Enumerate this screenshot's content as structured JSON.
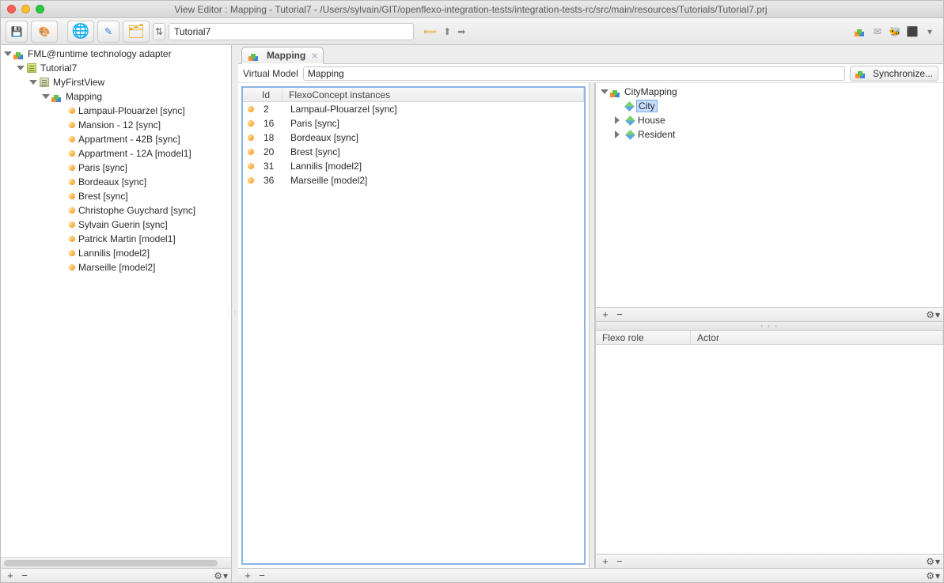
{
  "window": {
    "title": "View Editor : Mapping - Tutorial7 - /Users/sylvain/GIT/openflexo-integration-tests/integration-tests-rc/src/main/resources/Tutorials/Tutorial7.prj"
  },
  "toolbar": {
    "address_value": "Tutorial7"
  },
  "left_tree": {
    "root": "FML@runtime technology adapter",
    "project": "Tutorial7",
    "view": "MyFirstView",
    "mapping": "Mapping",
    "items": [
      "Lampaul-Plouarzel [sync]",
      "Mansion - 12 [sync]",
      "Appartment -  42B [sync]",
      "Appartment -  12A [model1]",
      "Paris [sync]",
      "Bordeaux [sync]",
      "Brest [sync]",
      "Christophe Guychard [sync]",
      "Sylvain Guerin [sync]",
      "Patrick Martin [model1]",
      "Lannilis [model2]",
      "Marseille [model2]"
    ]
  },
  "tab": {
    "label": "Mapping"
  },
  "vmbar": {
    "label": "Virtual Model",
    "value": "Mapping",
    "sync": "Synchronize..."
  },
  "table": {
    "headers": {
      "id": "Id",
      "fc": "FlexoConcept instances"
    },
    "rows": [
      {
        "id": "2",
        "fc": "Lampaul-Plouarzel [sync]"
      },
      {
        "id": "16",
        "fc": "Paris [sync]"
      },
      {
        "id": "18",
        "fc": "Bordeaux [sync]"
      },
      {
        "id": "20",
        "fc": "Brest [sync]"
      },
      {
        "id": "31",
        "fc": "Lannilis [model2]"
      },
      {
        "id": "36",
        "fc": "Marseille [model2]"
      }
    ]
  },
  "right_tree": {
    "root": "CityMapping",
    "items": [
      {
        "label": "City",
        "selected": true,
        "expandable": false
      },
      {
        "label": "House",
        "selected": false,
        "expandable": true
      },
      {
        "label": "Resident",
        "selected": false,
        "expandable": true
      }
    ]
  },
  "roles_table": {
    "headers": {
      "role": "Flexo role",
      "actor": "Actor"
    }
  },
  "footer": {
    "plus": "+",
    "minus": "−",
    "gear": "⚙",
    "caret": "▾"
  }
}
